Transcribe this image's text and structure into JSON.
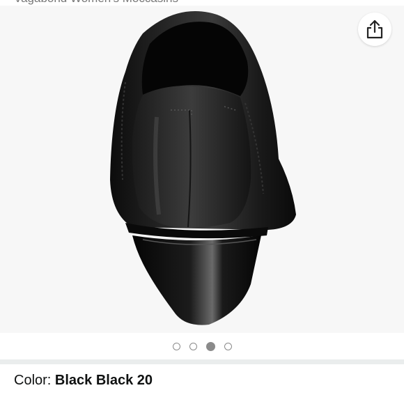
{
  "product": {
    "title": "Vagabond Women's Moccasins"
  },
  "gallery": {
    "image_count": 4,
    "active_index": 2
  },
  "color": {
    "label": "Color: ",
    "value": "Black Black 20"
  },
  "icons": {
    "share": "share-icon"
  },
  "colors": {
    "background": "#f7f7f7",
    "divider": "#eaeded",
    "dot": "#8a8a8a",
    "text": "#0f1111"
  }
}
